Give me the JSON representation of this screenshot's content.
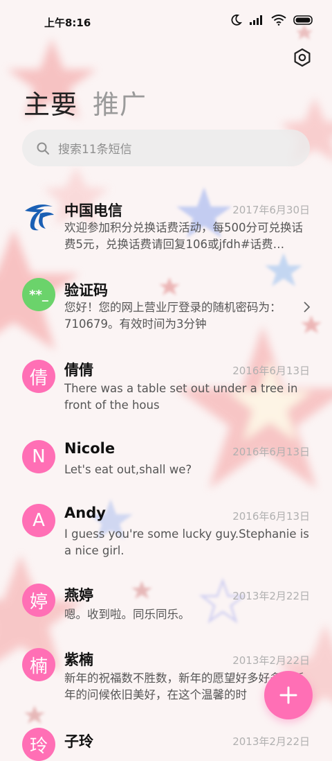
{
  "status_bar": {
    "time": "上午8:16"
  },
  "tabs": [
    {
      "label": "主要",
      "active": true
    },
    {
      "label": "推广",
      "active": false
    }
  ],
  "search": {
    "placeholder": "搜索11条短信"
  },
  "conversations": [
    {
      "name": "中国电信",
      "date": "2017年6月30日",
      "preview": "欢迎参加积分兑换话费活动，每500分可兑换话费5元，兑换话费请回复106或jfdh#话费…",
      "avatar": "china-telecom-logo"
    },
    {
      "name": "验证码",
      "date": "",
      "preview": "您好！您的网上营业厅登录的随机密码为：710679。有效时间为3分钟",
      "avatar_text": "**_",
      "avatar_color": "#6bd36b"
    },
    {
      "name": "倩倩",
      "date": "2016年6月13日",
      "preview": "There was a table set out under a tree in front of the hous",
      "avatar_text": "倩",
      "avatar_color": "#ff6fb5"
    },
    {
      "name": "Nicole",
      "date": "2016年6月13日",
      "preview": "Let's eat out,shall we?",
      "avatar_text": "N",
      "avatar_color": "#ff6fb5"
    },
    {
      "name": "Andy",
      "date": "2016年6月13日",
      "preview": "I guess you're some lucky guy.Stephanie is a nice girl.",
      "avatar_text": "A",
      "avatar_color": "#ff6fb5"
    },
    {
      "name": "燕婷",
      "date": "2013年2月22日",
      "preview": "嗯。收到啦。同乐同乐。",
      "avatar_text": "婷",
      "avatar_color": "#ff6fb5"
    },
    {
      "name": "紫楠",
      "date": "2013年2月22日",
      "preview": "新年的祝福数不胜数，新年的愿望好多好多，新年的问候依旧美好，在这个温馨的时",
      "avatar_text": "楠",
      "avatar_color": "#ff6fb5"
    },
    {
      "name": "子玲",
      "date": "2013年2月22日",
      "preview": "",
      "avatar_text": "玲",
      "avatar_color": "#ff6fb5"
    }
  ],
  "colors": {
    "accent": "#ff6fb5",
    "verify_green": "#6bd36b",
    "telecom_blue": "#1a5fb4"
  }
}
